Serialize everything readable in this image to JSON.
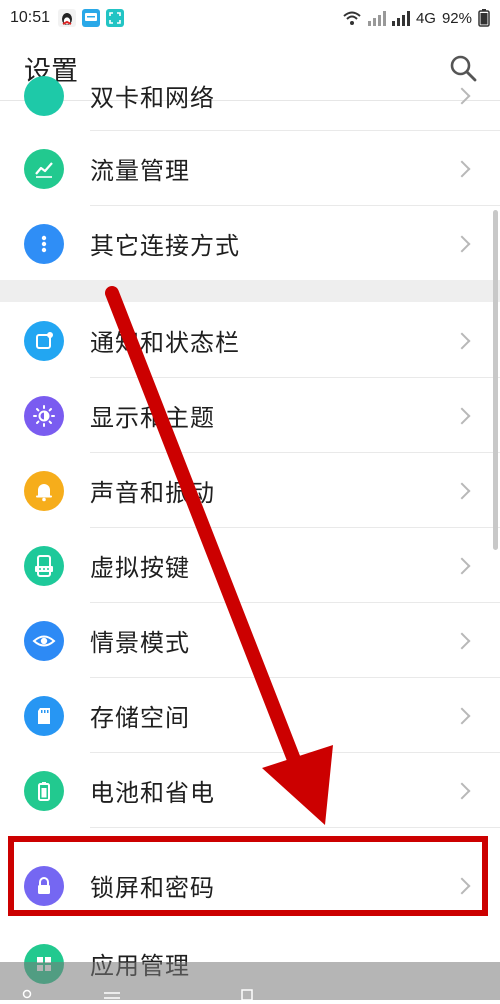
{
  "status_bar": {
    "time": "10:51",
    "network": "4G",
    "battery": "92%"
  },
  "header": {
    "title": "设置"
  },
  "items": [
    {
      "label": "双卡和网络",
      "icon": "sim-network-icon",
      "color": "#1ec9a8"
    },
    {
      "label": "流量管理",
      "icon": "traffic-chart-icon",
      "color": "#22c98f"
    },
    {
      "label": "其它连接方式",
      "icon": "more-dots-icon",
      "color": "#2f8ef6"
    },
    {
      "label": "通知和状态栏",
      "icon": "notification-icon",
      "color": "#22a6f2"
    },
    {
      "label": "显示和主题",
      "icon": "brightness-icon",
      "color": "#7a5cf0"
    },
    {
      "label": "声音和振动",
      "icon": "bell-icon",
      "color": "#f6ad1b"
    },
    {
      "label": "虚拟按键",
      "icon": "virtual-keys-icon",
      "color": "#1ec99a"
    },
    {
      "label": "情景模式",
      "icon": "eye-icon",
      "color": "#2d8af5"
    },
    {
      "label": "存储空间",
      "icon": "sd-card-icon",
      "color": "#2796f3"
    },
    {
      "label": "电池和省电",
      "icon": "battery-icon",
      "color": "#22c98f"
    },
    {
      "label": "锁屏和密码",
      "icon": "lock-icon",
      "color": "#7567f2"
    },
    {
      "label": "应用管理",
      "icon": "apps-grid-icon",
      "color": "#22c98f"
    }
  ],
  "colors": {
    "annotation_red": "#cc0000"
  }
}
